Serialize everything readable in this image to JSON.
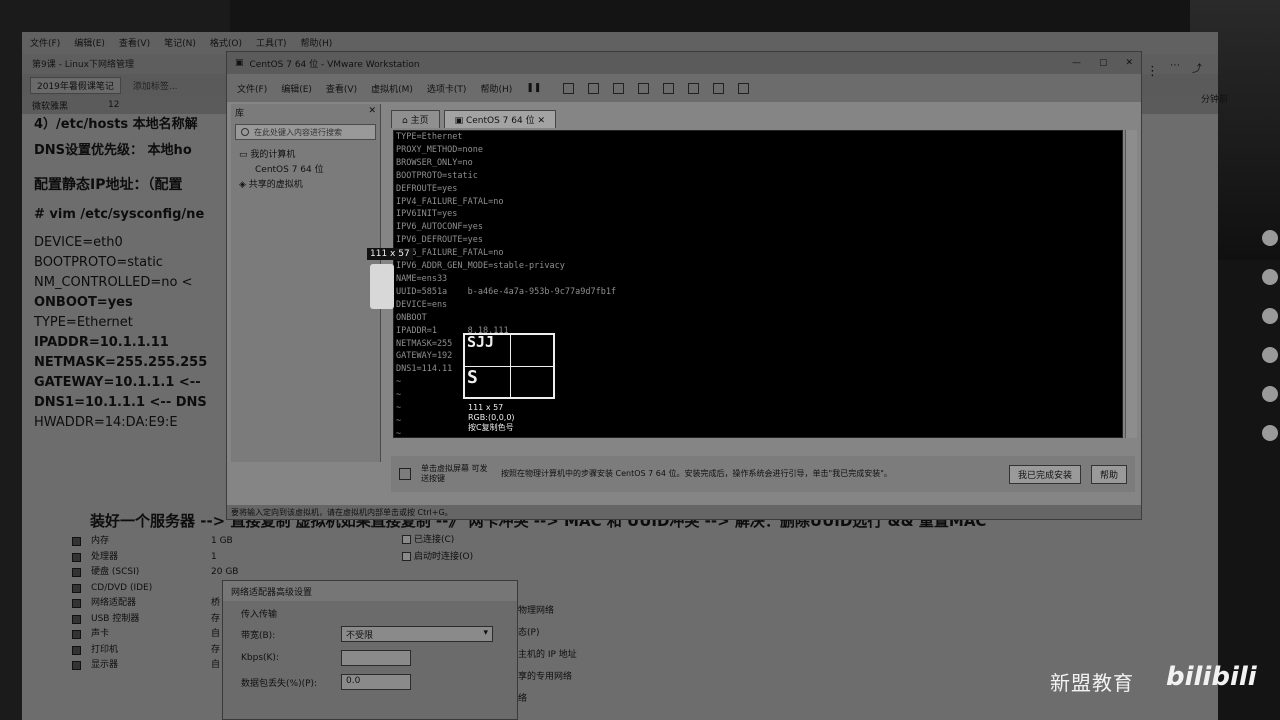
{
  "note": {
    "menu": [
      "文件(F)",
      "编辑(E)",
      "查看(V)",
      "笔记(N)",
      "格式(O)",
      "工具(T)",
      "帮助(H)"
    ],
    "title": "第9课 - Linux下网络管理",
    "notebook": "2019年暑假课笔记",
    "add_tag": "添加标签...",
    "font_name": "微软雅黑",
    "font_size": "12",
    "share_count": "分钟前",
    "doc_lines": [
      "4）/etc/hosts 本地名称解",
      "DNS设置优先级： 本地ho",
      "",
      "配置静态IP地址：（配置",
      "# vim /etc/sysconfig/ne",
      "DEVICE=eth0",
      "BOOTPROTO=static",
      "NM_CONTROLLED=no <",
      "ONBOOT=yes",
      "TYPE=Ethernet",
      "IPADDR=10.1.1.11",
      "NETMASK=255.255.255",
      "GATEWAY=10.1.1.1 <--",
      "DNS1=10.1.1.1 <-- DNS",
      "HWADDR=14:DA:E9:E"
    ],
    "summary": "装好一个服务器 --> 直接复制 虚拟机如果直接复制 --》 网卡冲突 --> MAC 和 UUID冲突 --> 解决：删除UUID选行 && 重置MAC"
  },
  "hardware": {
    "rows": [
      {
        "name": "内存",
        "value": "1 GB"
      },
      {
        "name": "处理器",
        "value": "1"
      },
      {
        "name": "硬盘 (SCSI)",
        "value": "20 GB"
      },
      {
        "name": "CD/DVD (IDE)",
        "value": ""
      },
      {
        "name": "网络适配器",
        "value": "桥"
      },
      {
        "name": "USB 控制器",
        "value": "存"
      },
      {
        "name": "声卡",
        "value": "自"
      },
      {
        "name": "打印机",
        "value": "存"
      },
      {
        "name": "显示器",
        "value": "自"
      }
    ],
    "checks": [
      "已连接(C)",
      "启动时连接(O)"
    ],
    "net_options": [
      "物理网络",
      "态(P)",
      "主机的 IP 地址",
      "享的专用网络",
      "络"
    ]
  },
  "adv_dialog": {
    "title": "网络适配器高级设置",
    "section": "传入传输",
    "bandwidth_label": "带宽(B):",
    "bandwidth_value": "不受限",
    "kbps_label": "Kbps(K):",
    "loss_label": "数据包丢失(%)(P):",
    "loss_value": "0.0"
  },
  "vmware": {
    "title": "CentOS 7 64 位 - VMware Workstation",
    "menu": [
      "文件(F)",
      "编辑(E)",
      "查看(V)",
      "虚拟机(M)",
      "选项卡(T)",
      "帮助(H)"
    ],
    "library_label": "库",
    "library_search_placeholder": "在此处键入内容进行搜索",
    "tree": [
      "我的计算机",
      "CentOS 7 64 位",
      "共享的虚拟机"
    ],
    "tabs": [
      "主页",
      "CentOS 7 64 位"
    ],
    "console_lines": [
      "TYPE=Ethernet",
      "PROXY_METHOD=none",
      "BROWSER_ONLY=no",
      "BOOTPROTO=static",
      "DEFROUTE=yes",
      "IPV4_FAILURE_FATAL=no",
      "IPV6INIT=yes",
      "IPV6_AUTOCONF=yes",
      "IPV6_DEFROUTE=yes",
      "IPV6_FAILURE_FATAL=no",
      "IPV6_ADDR_GEN_MODE=stable-privacy",
      "NAME=ens33",
      "UUID=5851a    b-a46e-4a7a-953b-9c77a9d7fb1f",
      "DEVICE=ens",
      "ONBOOT",
      "IPADDR=1      8.18.111",
      "NETMASK=255",
      "GATEWAY=192",
      "DNS1=114.11",
      "~",
      "~",
      "~",
      "~",
      "~"
    ],
    "hint_a": "单击虚拟屏幕 可发送按键",
    "hint_b": "按照在物理计算机中的步骤安装 CentOS 7 64 位。安装完成后，操作系统会进行引导，单击\"我已完成安装\"。",
    "btn_done": "我已完成安装",
    "btn_help": "帮助",
    "status": "要将输入定向到该虚拟机，请在虚拟机内部单击或按 Ctrl+G。"
  },
  "picker": {
    "size_tag": "111 x 57",
    "loupe_top": "SJJ",
    "loupe_bottom": "S",
    "info_size": "111 x 57",
    "info_rgb": "RGB:(0,0,0)",
    "info_copy": "按C复制色号"
  },
  "watermark": {
    "brand": "新盟教育",
    "logo": "bilibili"
  }
}
